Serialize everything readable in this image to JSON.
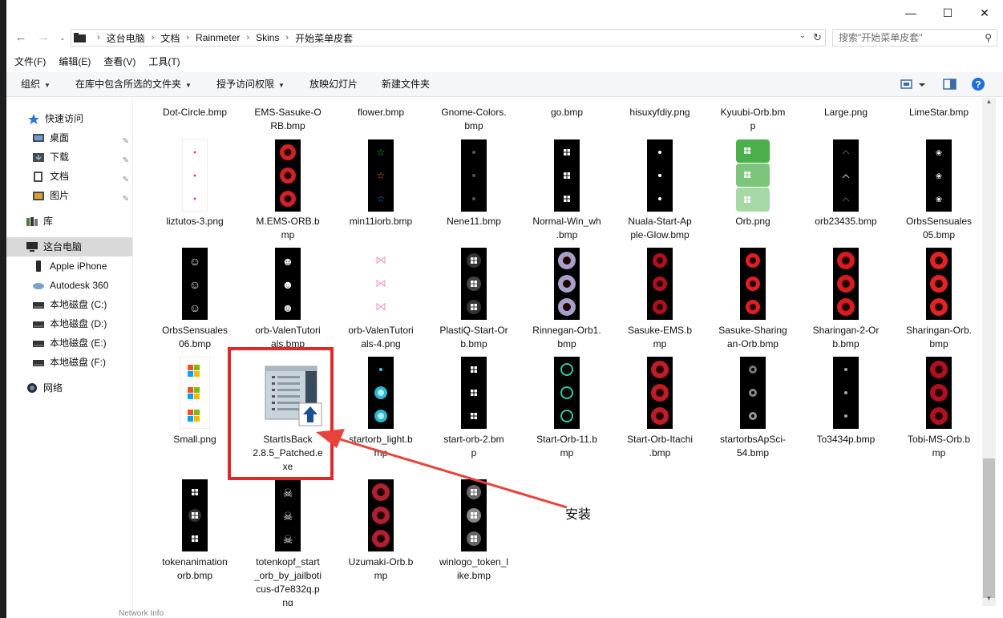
{
  "window": {
    "controls": {
      "minimize": "—",
      "maximize": "☐",
      "close": "✕"
    }
  },
  "address": {
    "breadcrumbs": [
      "这台电脑",
      "文档",
      "Rainmeter",
      "Skins",
      "开始菜单皮套"
    ],
    "search_placeholder": "搜索\"开始菜单皮套\""
  },
  "menubar": [
    "文件(F)",
    "编辑(E)",
    "查看(V)",
    "工具(T)"
  ],
  "commandbar": [
    "组织",
    "在库中包含所选的文件夹",
    "授予访问权限",
    "放映幻灯片",
    "新建文件夹"
  ],
  "sidebar": {
    "items": [
      {
        "label": "快速访问",
        "icon": "star-icon"
      },
      {
        "label": "桌面",
        "icon": "desktop-icon"
      },
      {
        "label": "下载",
        "icon": "download-icon"
      },
      {
        "label": "文档",
        "icon": "document-icon"
      },
      {
        "label": "图片",
        "icon": "picture-icon"
      },
      {
        "label": "库",
        "icon": "library-icon"
      },
      {
        "label": "这台电脑",
        "icon": "computer-icon"
      },
      {
        "label": "Apple iPhone",
        "icon": "phone-icon"
      },
      {
        "label": "Autodesk 360",
        "icon": "cloud-icon"
      },
      {
        "label": "本地磁盘 (C:)",
        "icon": "drive-icon"
      },
      {
        "label": "本地磁盘 (D:)",
        "icon": "drive-icon"
      },
      {
        "label": "本地磁盘 (E:)",
        "icon": "drive-icon"
      },
      {
        "label": "本地磁盘 (F:)",
        "icon": "drive-icon"
      },
      {
        "label": "网络",
        "icon": "network-icon"
      }
    ]
  },
  "files": {
    "row0": [
      "Dot-Circle.bmp",
      "EMS-Sasuke-O\nRB.bmp",
      "flower.bmp",
      "Gnome-Colors.\nbmp",
      "go.bmp",
      "hisuxyfdiy.png",
      "Kyuubi-Orb.bm\np",
      "Large.png",
      "LimeStar.bmp"
    ],
    "row1": [
      "liztutos-3.png",
      "M.EMS-ORB.b\nmp",
      "min11iorb.bmp",
      "Nene11.bmp",
      "Normal-Win_wh\n.bmp",
      "Nuala-Start-Ap\nple-Glow.bmp",
      "Orb.png",
      "orb23435.bmp",
      "OrbsSensuales\n05.bmp"
    ],
    "row2": [
      "OrbsSensuales\n06.bmp",
      "orb-ValenTutori\nals.bmp",
      "orb-ValenTutori\nals-4.png",
      "PlastiQ-Start-Or\nb.bmp",
      "Rinnegan-Orb1.\nbmp",
      "Sasuke-EMS.b\nmp",
      "Sasuke-Sharing\nan-Orb.bmp",
      "Sharingan-2-Or\nb.bmp",
      "Sharingan-Orb.\nbmp"
    ],
    "row3": [
      "Small.png",
      "StartIsBack\n2.8.5_Patched.e\nxe",
      "startorb_light.b\nmp",
      "start-orb-2.bm\np",
      "Start-Orb-11.b\nmp",
      "Start-Orb-Itachi\n.bmp",
      "startorbsApSci-\n54.bmp",
      "To3434p.bmp",
      "Tobi-MS-Orb.b\nmp"
    ],
    "row4": [
      "tokenanimation\norb.bmp",
      "totenkopf_start\n_orb_by_jailboti\ncus-d7e832q.p\nng",
      "Uzumaki-Orb.b\nmp",
      "winlogo_token_l\nike.bmp"
    ]
  },
  "annotation": {
    "label": "安装"
  },
  "background_hint": "Network Info"
}
